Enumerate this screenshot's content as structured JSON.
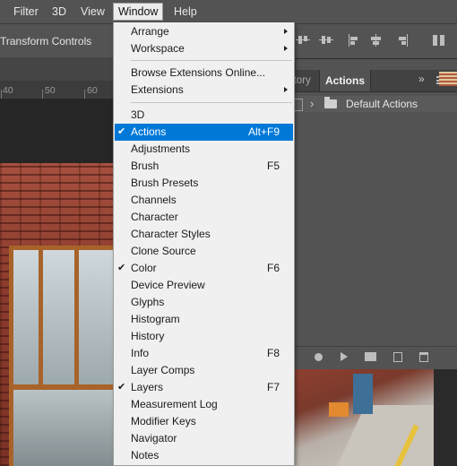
{
  "menubar": {
    "items": [
      {
        "label": "Filter"
      },
      {
        "label": "3D"
      },
      {
        "label": "View"
      },
      {
        "label": "Window"
      },
      {
        "label": "Help"
      }
    ]
  },
  "options_bar": {
    "transform_label": "Transform Controls"
  },
  "ruler": {
    "ticks": [
      "40",
      "50",
      "60"
    ]
  },
  "panel": {
    "tab_history": "History",
    "tab_actions": "Actions",
    "collapse_glyph": "»",
    "default_actions": "Default Actions"
  },
  "window_menu": {
    "items": [
      {
        "label": "Arrange",
        "submenu": true
      },
      {
        "label": "Workspace",
        "submenu": true
      },
      {
        "label": "Browse Extensions Online..."
      },
      {
        "label": "Extensions",
        "submenu": true
      },
      {
        "label": "3D"
      },
      {
        "label": "Actions",
        "shortcut": "Alt+F9",
        "checked": true,
        "highlighted": true
      },
      {
        "label": "Adjustments"
      },
      {
        "label": "Brush",
        "shortcut": "F5"
      },
      {
        "label": "Brush Presets"
      },
      {
        "label": "Channels"
      },
      {
        "label": "Character"
      },
      {
        "label": "Character Styles"
      },
      {
        "label": "Clone Source"
      },
      {
        "label": "Color",
        "shortcut": "F6",
        "checked": true
      },
      {
        "label": "Device Preview"
      },
      {
        "label": "Glyphs"
      },
      {
        "label": "Histogram"
      },
      {
        "label": "History"
      },
      {
        "label": "Info",
        "shortcut": "F8"
      },
      {
        "label": "Layer Comps"
      },
      {
        "label": "Layers",
        "shortcut": "F7",
        "checked": true
      },
      {
        "label": "Measurement Log"
      },
      {
        "label": "Modifier Keys"
      },
      {
        "label": "Navigator"
      },
      {
        "label": "Notes"
      }
    ],
    "check_glyph": "✔",
    "highlight_color": "#0078d7"
  }
}
